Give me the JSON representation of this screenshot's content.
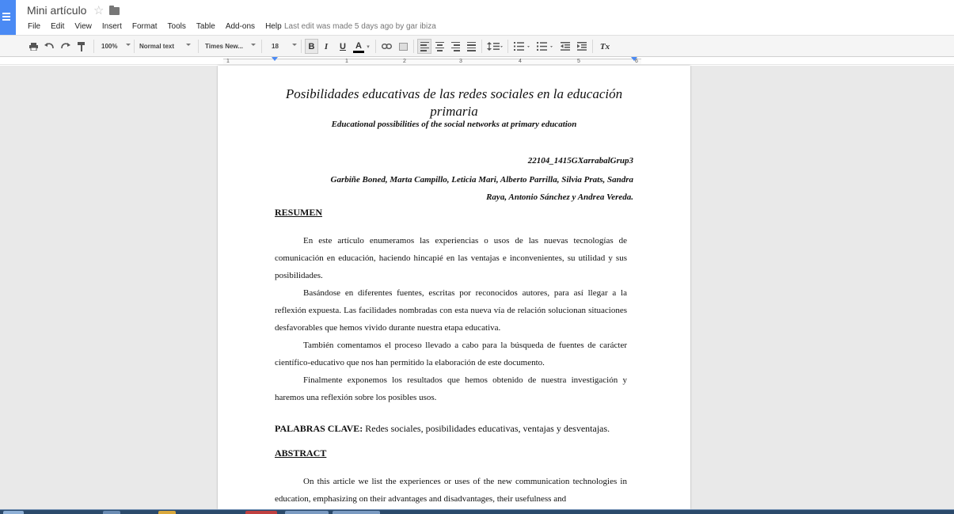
{
  "app": {
    "doc_title": "Mini artículo",
    "last_edit": "Last edit was made 5 days ago by gar ibiza"
  },
  "menu": [
    "File",
    "Edit",
    "View",
    "Insert",
    "Format",
    "Tools",
    "Table",
    "Add-ons",
    "Help"
  ],
  "toolbar": {
    "zoom": "100%",
    "style": "Normal text",
    "font": "Times New...",
    "size": "18",
    "bold": "B",
    "italic": "I",
    "underline": "U",
    "text_color": "A",
    "clear_format": "Tx"
  },
  "ruler": [
    "1",
    "1",
    "2",
    "3",
    "4",
    "5",
    "6"
  ],
  "document": {
    "title": "Posibilidades educativas de las redes sociales en la educación primaria",
    "subtitle": "Educational possibilities of the social networks at primary education",
    "code": "22104_1415GXarrabalGrup3",
    "authors_1": "Garbiñe Boned, Marta Campillo, Leticia Mari, Alberto Parrilla, Silvia Prats, Sandra",
    "authors_2": "Raya, Antonio Sánchez y Andrea Vereda.",
    "resumen_heading": "RESUMEN",
    "resumen_p1": "En este artículo enumeramos las experiencias o usos de las nuevas tecnologías de comunicación en educación, haciendo hincapié en las ventajas e inconvenientes, su utilidad y sus posibilidades.",
    "resumen_p2": "Basándose en diferentes fuentes, escritas por reconocidos autores, para así llegar a la reflexión expuesta. Las facilidades nombradas con esta nueva vía de relación solucionan situaciones desfavorables que hemos vivido durante nuestra etapa educativa.",
    "resumen_p3": "También comentamos el proceso llevado a cabo para la búsqueda de fuentes de carácter científico-educativo que nos han permitido la elaboración de este documento.",
    "resumen_p4": "Finalmente exponemos los resultados que hemos obtenido de nuestra investigación y haremos una reflexión sobre los posibles usos.",
    "keywords_label": "PALABRAS CLAVE:",
    "keywords_text": " Redes sociales, posibilidades educativas, ventajas y desventajas.",
    "abstract_heading": "ABSTRACT",
    "abstract_p1": "On this article we list the experiences or uses of the new communication technologies in education, emphasizing on their advantages and disadvantages, their usefulness and"
  },
  "colors": {
    "app_blue": "#4a8af4",
    "canvas_bg": "#e9e9e9",
    "toolbar_bg": "#f5f5f5"
  }
}
